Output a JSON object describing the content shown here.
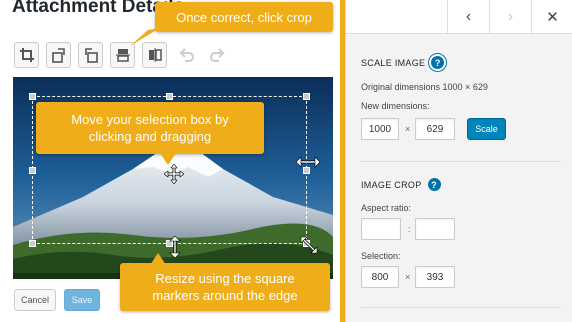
{
  "header": {
    "title": "Attachment Details"
  },
  "toolbar": {
    "buttons": [
      {
        "name": "crop-icon"
      },
      {
        "name": "rotate-left-icon"
      },
      {
        "name": "rotate-right-icon"
      },
      {
        "name": "flip-vertical-icon"
      },
      {
        "name": "flip-horizontal-icon"
      },
      {
        "name": "undo-icon"
      },
      {
        "name": "redo-icon"
      }
    ]
  },
  "callouts": {
    "crop": "Once correct, click crop",
    "move": "Move your selection box by clicking and dragging",
    "resize": "Resize using the square markers around the edge"
  },
  "actions": {
    "cancel": "Cancel",
    "save": "Save"
  },
  "nav": {
    "prev": "‹",
    "next": "›",
    "close": "✕"
  },
  "scale": {
    "heading": "SCALE IMAGE",
    "original": "Original dimensions 1000 × 629",
    "new_label": "New dimensions:",
    "width": "1000",
    "height": "629",
    "times": "×",
    "button": "Scale"
  },
  "crop": {
    "heading": "IMAGE CROP",
    "aspect_label": "Aspect ratio:",
    "aspect_w": "",
    "aspect_h": "",
    "colon": ":",
    "selection_label": "Selection:",
    "sel_w": "800",
    "sel_h": "393",
    "times": "×"
  },
  "colors": {
    "accent": "#f0ad1a",
    "primary": "#0085ba",
    "help": "#0073aa"
  }
}
